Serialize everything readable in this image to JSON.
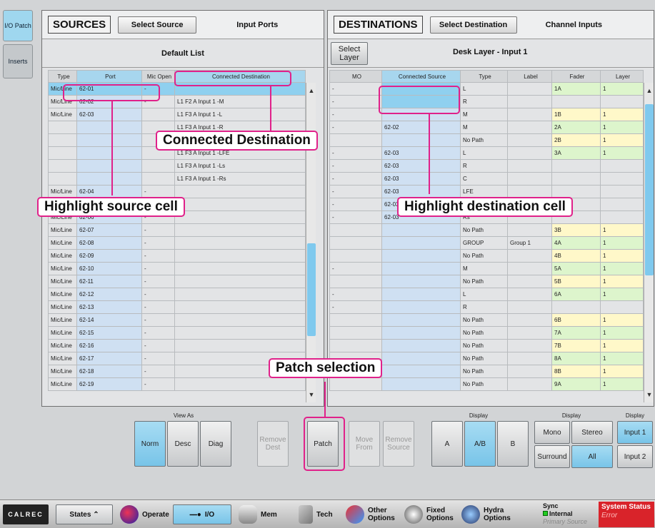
{
  "left_tabs": [
    "I/O Patch",
    "Inserts"
  ],
  "sources": {
    "title": "SOURCES",
    "select_btn": "Select Source",
    "mode_label": "Input Ports",
    "list_name": "Default List",
    "columns": [
      "Type",
      "Port",
      "Mic Open",
      "Connected Destination"
    ],
    "rows": [
      [
        "Mic/Line",
        "62-01",
        "-",
        ""
      ],
      [
        "Mic/Line",
        "62-02",
        "-",
        "L1 F2 A Input 1 -M"
      ],
      [
        "Mic/Line",
        "62-03",
        "",
        "L1 F3 A Input 1 -L"
      ],
      [
        "",
        "",
        "",
        "L1 F3 A Input 1 -R"
      ],
      [
        "",
        "",
        "",
        "L1 F3 A Input 1 -C"
      ],
      [
        "",
        "",
        "",
        "L1 F3 A Input 1 -LFE"
      ],
      [
        "",
        "",
        "",
        "L1 F3 A Input 1 -Ls"
      ],
      [
        "",
        "",
        "",
        "L1 F3 A Input 1 -Rs"
      ],
      [
        "Mic/Line",
        "62-04",
        "-",
        ""
      ],
      [
        "Mic/Line",
        "62-05",
        "-",
        ""
      ],
      [
        "Mic/Line",
        "62-06",
        "-",
        ""
      ],
      [
        "Mic/Line",
        "62-07",
        "-",
        ""
      ],
      [
        "Mic/Line",
        "62-08",
        "-",
        ""
      ],
      [
        "Mic/Line",
        "62-09",
        "-",
        ""
      ],
      [
        "Mic/Line",
        "62-10",
        "-",
        ""
      ],
      [
        "Mic/Line",
        "62-11",
        "-",
        ""
      ],
      [
        "Mic/Line",
        "62-12",
        "-",
        ""
      ],
      [
        "Mic/Line",
        "62-13",
        "-",
        ""
      ],
      [
        "Mic/Line",
        "62-14",
        "-",
        ""
      ],
      [
        "Mic/Line",
        "62-15",
        "-",
        ""
      ],
      [
        "Mic/Line",
        "62-16",
        "-",
        ""
      ],
      [
        "Mic/Line",
        "62-17",
        "-",
        ""
      ],
      [
        "Mic/Line",
        "62-18",
        "-",
        ""
      ],
      [
        "Mic/Line",
        "62-19",
        "-",
        ""
      ]
    ]
  },
  "destinations": {
    "title": "DESTINATIONS",
    "select_btn": "Select Destination",
    "mode_label": "Channel Inputs",
    "select_layer": "Select Layer",
    "layer_name": "Desk Layer - Input 1",
    "columns": [
      "MO",
      "Connected Source",
      "Type",
      "Label",
      "Fader",
      "Layer"
    ],
    "rows": [
      [
        "-",
        "",
        "L",
        "",
        "1A",
        "1",
        "g"
      ],
      [
        "-",
        "",
        "R",
        "",
        "",
        "",
        ""
      ],
      [
        "-",
        "",
        "M",
        "",
        "1B",
        "1",
        "y"
      ],
      [
        "-",
        "62-02",
        "M",
        "",
        "2A",
        "1",
        "g"
      ],
      [
        "",
        "",
        "No Path",
        "",
        "2B",
        "1",
        "y"
      ],
      [
        "-",
        "62-03",
        "L",
        "",
        "3A",
        "1",
        "g"
      ],
      [
        "-",
        "62-03",
        "R",
        "",
        "",
        "",
        ""
      ],
      [
        "-",
        "62-03",
        "C",
        "",
        "",
        "",
        ""
      ],
      [
        "-",
        "62-03",
        "LFE",
        "",
        "",
        "",
        ""
      ],
      [
        "-",
        "62-03",
        "Ls",
        "",
        "",
        "",
        ""
      ],
      [
        "-",
        "62-03",
        "Rs",
        "",
        "",
        "",
        ""
      ],
      [
        "",
        "",
        "No Path",
        "",
        "3B",
        "1",
        "y"
      ],
      [
        "",
        "",
        "GROUP",
        "Group 1",
        "4A",
        "1",
        "g"
      ],
      [
        "",
        "",
        "No Path",
        "",
        "4B",
        "1",
        "y"
      ],
      [
        "-",
        "",
        "M",
        "",
        "5A",
        "1",
        "g"
      ],
      [
        "",
        "",
        "No Path",
        "",
        "5B",
        "1",
        "y"
      ],
      [
        "-",
        "",
        "L",
        "",
        "6A",
        "1",
        "g"
      ],
      [
        "-",
        "",
        "R",
        "",
        "",
        "",
        ""
      ],
      [
        "",
        "",
        "No Path",
        "",
        "6B",
        "1",
        "y"
      ],
      [
        "",
        "",
        "No Path",
        "",
        "7A",
        "1",
        "g"
      ],
      [
        "",
        "",
        "No Path",
        "",
        "7B",
        "1",
        "y"
      ],
      [
        "",
        "",
        "No Path",
        "",
        "8A",
        "1",
        "g"
      ],
      [
        "",
        "",
        "No Path",
        "",
        "8B",
        "1",
        "y"
      ],
      [
        "",
        "",
        "No Path",
        "",
        "9A",
        "1",
        "g"
      ]
    ]
  },
  "controls": {
    "view_as": "View As",
    "norm": "Norm",
    "desc": "Desc",
    "diag": "Diag",
    "remove_dest": "Remove Dest",
    "patch": "Patch",
    "move_from": "Move From",
    "remove_source": "Remove Source",
    "display": "Display",
    "a": "A",
    "ab": "A/B",
    "b": "B",
    "mono": "Mono",
    "stereo": "Stereo",
    "surround": "Surround",
    "all": "All",
    "input1": "Input 1",
    "input2": "Input 2"
  },
  "callouts": {
    "connected_destination": "Connected Destination",
    "highlight_source": "Highlight source cell",
    "highlight_destination": "Highlight destination cell",
    "patch_selection": "Patch selection"
  },
  "taskbar": {
    "logo": "CALREC",
    "states": "States",
    "operate": "Operate",
    "io": "I/O",
    "mem": "Mem",
    "tech": "Tech",
    "other_options": "Other Options",
    "fixed_options": "Fixed Options",
    "hydra_options": "Hydra Options",
    "sync": "Sync",
    "sync_internal": "Internal",
    "sync_primary": "Primary Source",
    "system_status": "System Status",
    "system_error": "Error"
  },
  "colors": {
    "accent_blue": "#8fd0ef",
    "callout_pink": "#e0218a",
    "fader_green": "#ddf5cc",
    "fader_yellow": "#fff8c9",
    "status_red": "#d9232a"
  }
}
